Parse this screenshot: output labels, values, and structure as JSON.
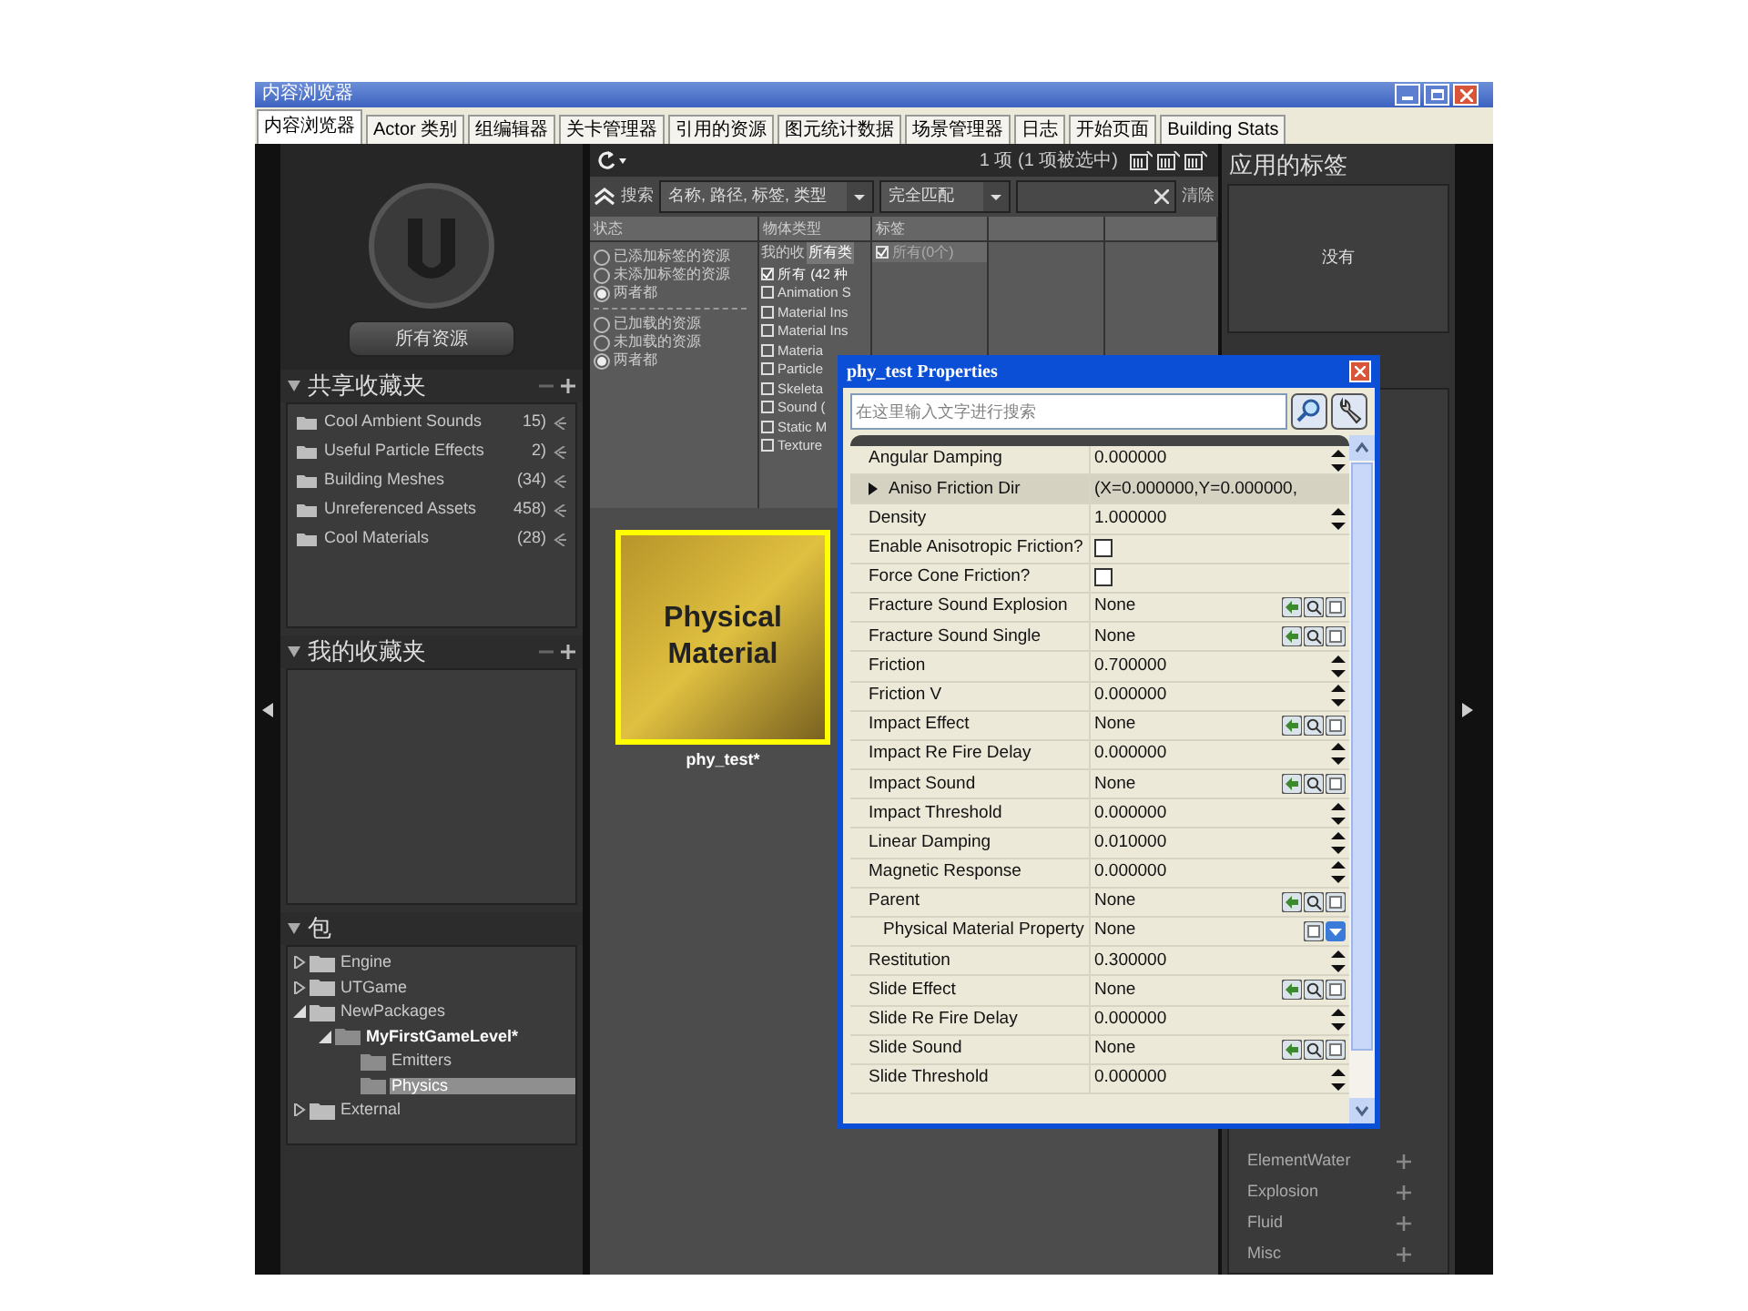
{
  "window": {
    "title": "内容浏览器"
  },
  "tabs": [
    {
      "label": "内容浏览器",
      "selected": true
    },
    {
      "label": "Actor 类别",
      "selected": false
    },
    {
      "label": "组编辑器",
      "selected": false
    },
    {
      "label": "关卡管理器",
      "selected": false
    },
    {
      "label": "引用的资源",
      "selected": false
    },
    {
      "label": "图元统计数据",
      "selected": false
    },
    {
      "label": "场景管理器",
      "selected": false
    },
    {
      "label": "日志",
      "selected": false
    },
    {
      "label": "开始页面",
      "selected": false
    },
    {
      "label": "Building Stats",
      "selected": false
    }
  ],
  "sidebar": {
    "all_assets_button": "所有资源",
    "shared_collections": {
      "title": "共享收藏夹",
      "items": [
        {
          "name": "Cool Ambient Sounds",
          "count": "15)"
        },
        {
          "name": "Useful Particle Effects",
          "count": "2)"
        },
        {
          "name": "Building Meshes",
          "count": "(34)"
        },
        {
          "name": "Unreferenced Assets",
          "count": "458)"
        },
        {
          "name": "Cool Materials",
          "count": "(28)"
        }
      ]
    },
    "my_collections": {
      "title": "我的收藏夹"
    },
    "packages": {
      "title": "包",
      "tree": [
        {
          "label": "Engine",
          "expanded": false,
          "selected": false,
          "bold": false
        },
        {
          "label": "UTGame",
          "expanded": false,
          "selected": false,
          "bold": false
        },
        {
          "label": "NewPackages",
          "expanded": true,
          "selected": false,
          "bold": false,
          "children": [
            {
              "label": "MyFirstGameLevel*",
              "expanded": true,
              "selected": false,
              "bold": true,
              "children": [
                {
                  "label": "Emitters",
                  "selected": false,
                  "bold": false
                },
                {
                  "label": "Physics",
                  "selected": true,
                  "bold": false
                }
              ]
            }
          ]
        },
        {
          "label": "External",
          "expanded": false,
          "selected": false,
          "bold": false
        }
      ]
    }
  },
  "toolbar": {
    "status": "1 项 (1 项被选中)"
  },
  "search": {
    "label": "搜索",
    "field_combo": "名称, 路径, 标签, 类型",
    "match_combo": "完全匹配",
    "clear": "清除"
  },
  "filters": {
    "columns": [
      "状态",
      "物体类型",
      "标签"
    ],
    "status_groups": [
      [
        {
          "label": "已添加标签的资源",
          "selected": false
        },
        {
          "label": "未添加标签的资源",
          "selected": false
        },
        {
          "label": "两者都",
          "selected": true
        }
      ],
      [
        {
          "label": "已加载的资源",
          "selected": false
        },
        {
          "label": "未加载的资源",
          "selected": false
        },
        {
          "label": "两者都",
          "selected": true
        }
      ]
    ],
    "type_tabs": [
      {
        "label": "我的收",
        "selected": false
      },
      {
        "label": "所有类",
        "selected": true
      }
    ],
    "types": [
      {
        "label": "所有 (42 种",
        "checked": true
      },
      {
        "label": "Animation S",
        "checked": false
      },
      {
        "label": "Material Ins",
        "checked": false
      },
      {
        "label": "Material Ins",
        "checked": false
      },
      {
        "label": "Materia",
        "checked": false
      },
      {
        "label": "Particle",
        "checked": false
      },
      {
        "label": "Skeleta",
        "checked": false
      },
      {
        "label": "Sound (",
        "checked": false
      },
      {
        "label": "Static M",
        "checked": false
      },
      {
        "label": "Texture",
        "checked": false
      }
    ],
    "tags": [
      {
        "label": "所有(0个)",
        "checked": true
      }
    ]
  },
  "assets": [
    {
      "thumbnail_text": "Physical Material",
      "name": "phy_test*",
      "selected": true
    }
  ],
  "tags_panel": {
    "title": "应用的标签",
    "empty": "没有",
    "categories": [
      "ElementWater",
      "Explosion",
      "Fluid",
      "Misc"
    ]
  },
  "dialog": {
    "title": "phy_test Properties",
    "placeholder": "在这里输入文字进行搜索",
    "rows": [
      {
        "name": "Angular Damping",
        "value": "0.000000",
        "kind": "number"
      },
      {
        "name": "Aniso Friction Dir",
        "value": "(X=0.000000,Y=0.000000,",
        "kind": "struct"
      },
      {
        "name": "Density",
        "value": "1.000000",
        "kind": "number"
      },
      {
        "name": "Enable Anisotropic Friction?",
        "kind": "checkbox",
        "checked": false
      },
      {
        "name": "Force Cone Friction?",
        "kind": "checkbox",
        "checked": false
      },
      {
        "name": "Fracture Sound Explosion",
        "value": "None",
        "kind": "object"
      },
      {
        "name": "Fracture Sound Single",
        "value": "None",
        "kind": "object"
      },
      {
        "name": "Friction",
        "value": "0.700000",
        "kind": "number"
      },
      {
        "name": "Friction V",
        "value": "0.000000",
        "kind": "number"
      },
      {
        "name": "Impact Effect",
        "value": "None",
        "kind": "object"
      },
      {
        "name": "Impact Re Fire Delay",
        "value": "0.000000",
        "kind": "number"
      },
      {
        "name": "Impact Sound",
        "value": "None",
        "kind": "object"
      },
      {
        "name": "Impact Threshold",
        "value": "0.000000",
        "kind": "number"
      },
      {
        "name": "Linear Damping",
        "value": "0.010000",
        "kind": "number"
      },
      {
        "name": "Magnetic Response",
        "value": "0.000000",
        "kind": "number"
      },
      {
        "name": "Parent",
        "value": "None",
        "kind": "object"
      },
      {
        "name": "Physical Material Property",
        "value": "None",
        "kind": "component"
      },
      {
        "name": "Restitution",
        "value": "0.300000",
        "kind": "number"
      },
      {
        "name": "Slide Effect",
        "value": "None",
        "kind": "object"
      },
      {
        "name": "Slide Re Fire Delay",
        "value": "0.000000",
        "kind": "number"
      },
      {
        "name": "Slide Sound",
        "value": "None",
        "kind": "object"
      },
      {
        "name": "Slide Threshold",
        "value": "0.000000",
        "kind": "number"
      }
    ]
  }
}
